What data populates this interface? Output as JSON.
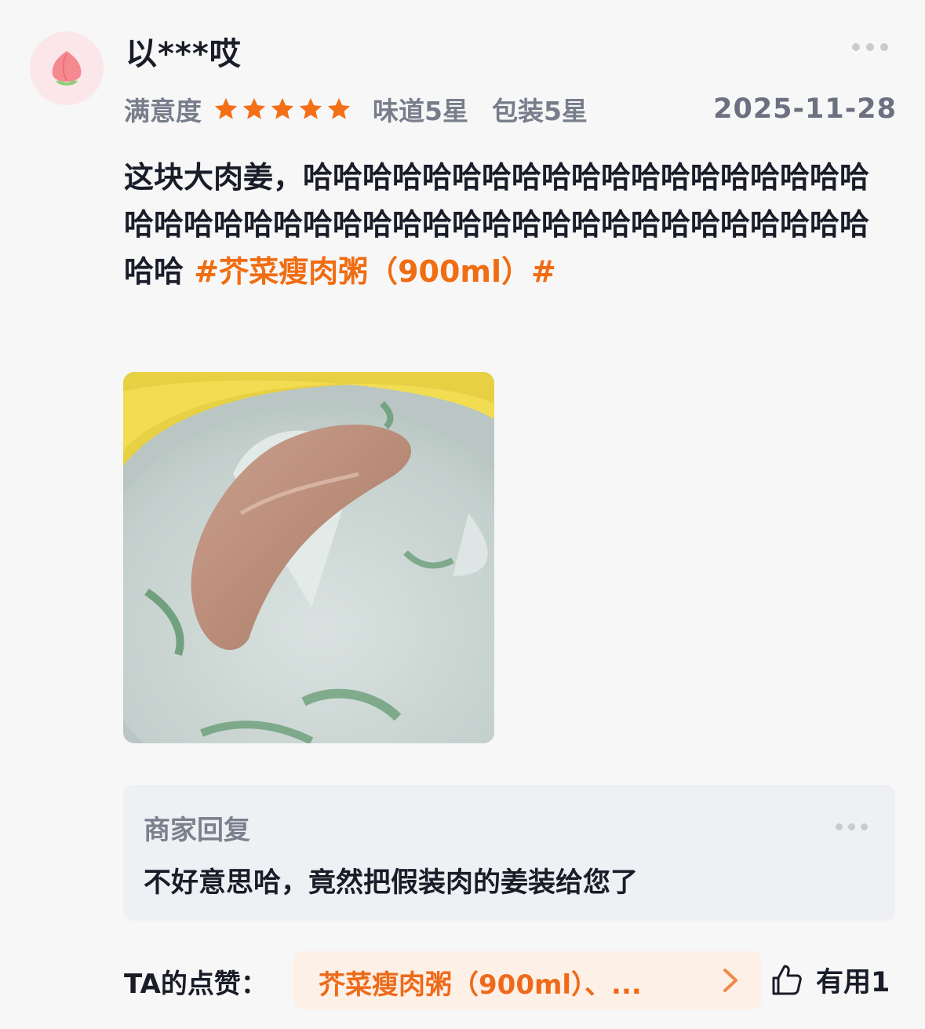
{
  "user": {
    "name": "以***哎",
    "avatar_icon": "peach-icon"
  },
  "rating": {
    "label": "满意度",
    "stars": 5,
    "star_color": "#f56f16",
    "taste": "味道5星",
    "packaging": "包装5星",
    "date": "2025-11-28"
  },
  "review": {
    "text": "这块大肉姜，哈哈哈哈哈哈哈哈哈哈哈哈哈哈哈哈哈哈哈哈哈哈哈哈哈哈哈哈哈哈哈哈哈哈哈哈哈哈哈哈哈哈哈哈哈哈 ",
    "tag": "#芥菜瘦肉粥（900ml）#",
    "tag_color": "#f06d12"
  },
  "photo": {
    "icon": "porridge-photo"
  },
  "merchant_reply": {
    "title": "商家回复",
    "text": "不好意思哈，竟然把假装肉的姜装给您了"
  },
  "footer": {
    "likes_label": "TA的点赞：",
    "liked_items": "芥菜瘦肉粥（900ml）、...",
    "useful_label": "有用",
    "useful_count": "1"
  }
}
